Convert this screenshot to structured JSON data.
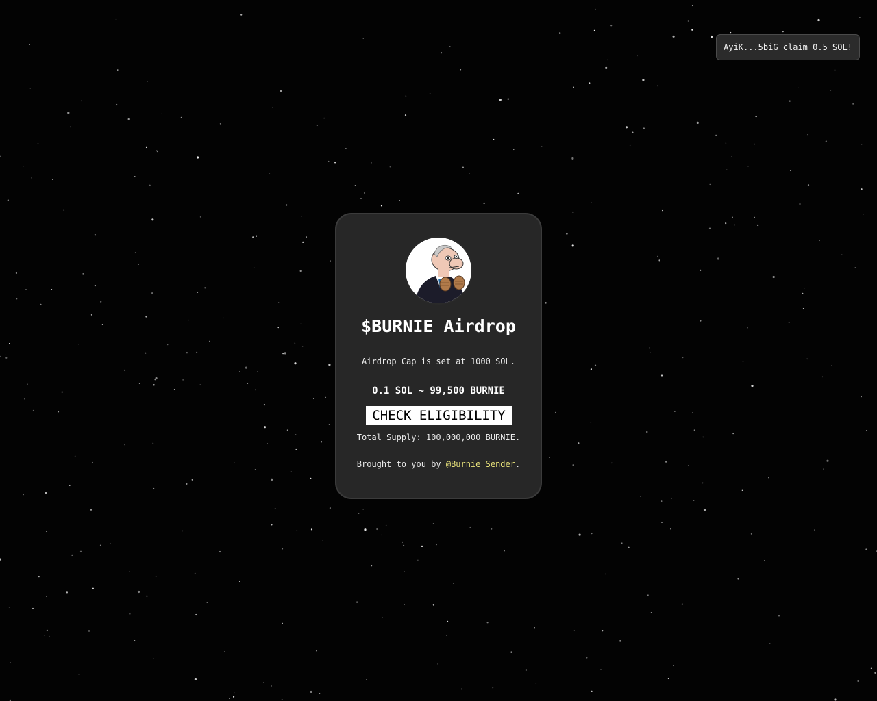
{
  "background": {
    "color": "#030303",
    "star_color": "#ffffff"
  },
  "toast": {
    "text": "AyiK...5biG claim 0.5 SOL!"
  },
  "card": {
    "avatar_icon": "burnie-mascot-avatar",
    "title": "$BURNIE Airdrop",
    "cap_text": "Airdrop Cap is set at 1000 SOL.",
    "rate_text": "0.1 SOL ~ 99,500 BURNIE",
    "check_button_label": "CHECK ELIGIBILITY",
    "supply_text": "Total Supply: 100,000,000 BURNIE.",
    "credit_prefix": "Brought to you by ",
    "credit_link": "@Burnie Sender",
    "credit_suffix": "."
  },
  "colors": {
    "card_bg": "#272727",
    "link": "#e8e27a",
    "button_bg": "#ffffff",
    "button_text": "#000000"
  }
}
